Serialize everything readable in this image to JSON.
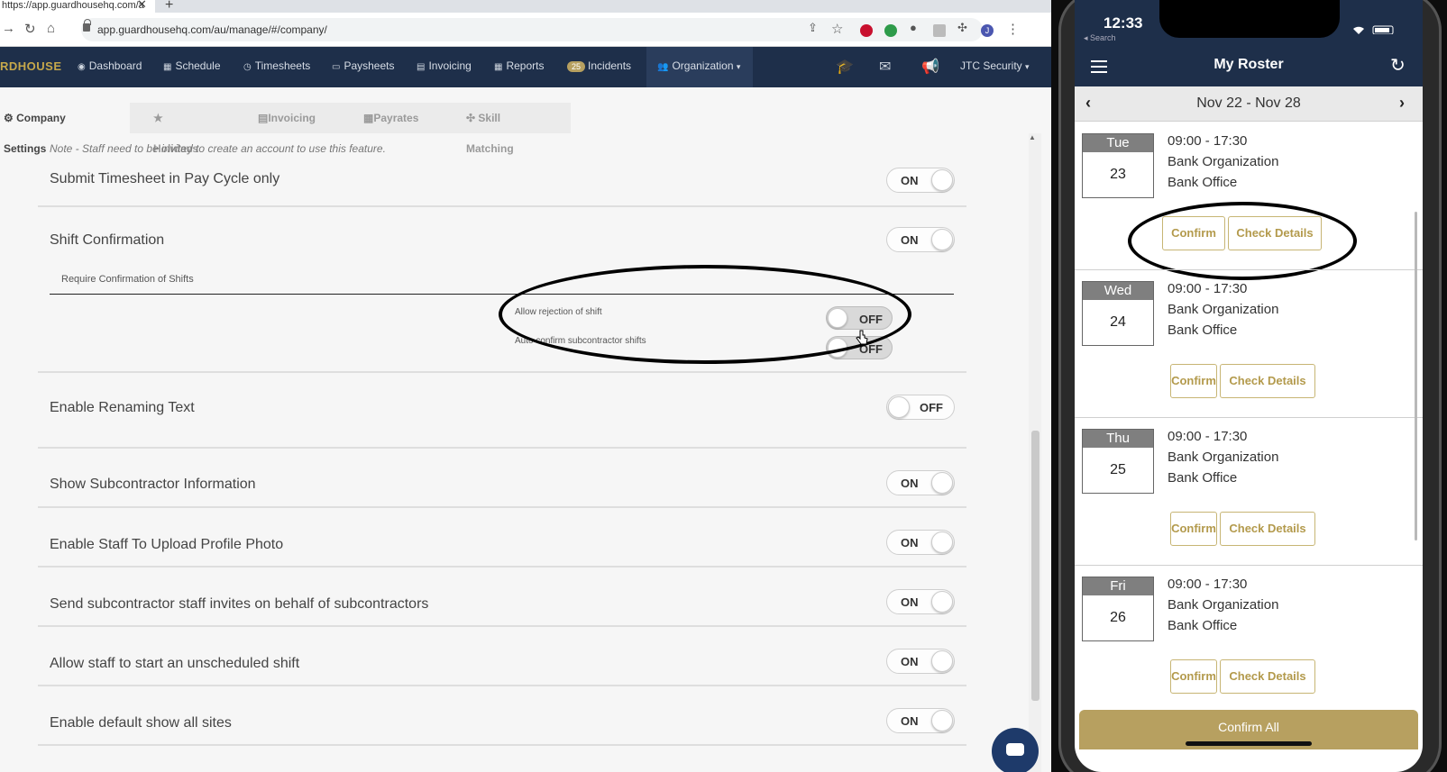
{
  "browser": {
    "tab_title": "https://app.guardhousehq.com/a",
    "url": "app.guardhousehq.com/au/manage/#/company/",
    "profile_initial": "J"
  },
  "appnav": {
    "brand": "RDHOUSE",
    "items": [
      {
        "icon": "dashboard-icon",
        "label": "Dashboard"
      },
      {
        "icon": "calendar-icon",
        "label": "Schedule"
      },
      {
        "icon": "clock-icon",
        "label": "Timesheets"
      },
      {
        "icon": "money-icon",
        "label": "Paysheets"
      },
      {
        "icon": "invoice-icon",
        "label": "Invoicing"
      },
      {
        "icon": "table-icon",
        "label": "Reports"
      },
      {
        "icon": "badge",
        "label": "Incidents",
        "badge": "25"
      },
      {
        "icon": "users-icon",
        "label": "Organization"
      }
    ],
    "account": "JTC Security"
  },
  "subtabs": [
    "Company Settings",
    "Holidays",
    "Invoicing",
    "Payrates",
    "Skill Matching"
  ],
  "settings": {
    "note": "Note - Staff need to be invited to create an account to use this feature.",
    "rows": [
      {
        "label": "Submit Timesheet in Pay Cycle only",
        "state": "ON"
      },
      {
        "label": "Shift Confirmation",
        "state": "ON"
      },
      {
        "label": "Enable Renaming Text",
        "state": "OFF"
      },
      {
        "label": "Show Subcontractor Information",
        "state": "ON"
      },
      {
        "label": "Enable Staff To Upload Profile Photo",
        "state": "ON"
      },
      {
        "label": "Send subcontractor staff invites on behalf of subcontractors",
        "state": "ON"
      },
      {
        "label": "Allow staff to start an unscheduled shift",
        "state": "ON"
      },
      {
        "label": "Enable default show all sites",
        "state": "ON"
      }
    ],
    "shift_sub": {
      "heading": "Require Confirmation of Shifts",
      "allow_rejection": {
        "label": "Allow rejection of shift",
        "state": "OFF"
      },
      "auto_confirm": {
        "label": "Auto confirm subcontractor shifts",
        "state": "OFF"
      }
    }
  },
  "phone": {
    "time": "12:33",
    "back_label": "◂ Search",
    "title": "My Roster",
    "week": "Nov 22 - Nov 28",
    "days": [
      {
        "dayname": "Tue",
        "daynum": "23",
        "time": "09:00 - 17:30",
        "org": "Bank Organization",
        "site": "Bank Office",
        "confirm": "Confirm",
        "details": "Check Details"
      },
      {
        "dayname": "Wed",
        "daynum": "24",
        "time": "09:00 - 17:30",
        "org": "Bank Organization",
        "site": "Bank Office",
        "confirm": "Confirm",
        "details": "Check Details"
      },
      {
        "dayname": "Thu",
        "daynum": "25",
        "time": "09:00 - 17:30",
        "org": "Bank Organization",
        "site": "Bank Office",
        "confirm": "Confirm",
        "details": "Check Details"
      },
      {
        "dayname": "Fri",
        "daynum": "26",
        "time": "09:00 - 17:30",
        "org": "Bank Organization",
        "site": "Bank Office",
        "confirm": "Confirm",
        "details": "Check Details"
      }
    ],
    "confirm_all": "Confirm All"
  },
  "colors": {
    "navy": "#1e2f4a",
    "gold": "#b7a060",
    "gold_text": "#b39a4c"
  }
}
